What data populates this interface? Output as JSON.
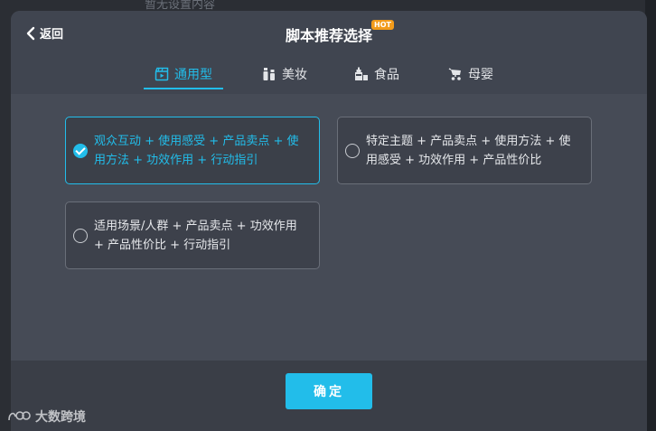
{
  "backdrop": {
    "partial_text": "暂无设置内容"
  },
  "header": {
    "back_label": "返回",
    "title": "脚本推荐选择",
    "badge": "HOT"
  },
  "tabs": [
    {
      "label": "通用型",
      "icon": "clapperboard-icon",
      "active": true
    },
    {
      "label": "美妆",
      "icon": "cosmetics-icon",
      "active": false
    },
    {
      "label": "食品",
      "icon": "food-icon",
      "active": false
    },
    {
      "label": "母婴",
      "icon": "stroller-icon",
      "active": false
    }
  ],
  "options": [
    {
      "text": "观众互动 + 使用感受 + 产品卖点 + 使用方法 + 功效作用 + 行动指引",
      "selected": true
    },
    {
      "text": "特定主题 + 产品卖点 + 使用方法 + 使用感受 + 功效作用 + 产品性价比",
      "selected": false
    },
    {
      "text": "适用场景/人群 + 产品卖点 + 功效作用 + 产品性价比 + 行动指引",
      "selected": false
    }
  ],
  "footer": {
    "confirm_label": "确定"
  },
  "watermark": {
    "text": "大数跨境"
  },
  "colors": {
    "accent": "#22bdea",
    "badge": "#f29b1b",
    "modal_bg": "#464b56"
  }
}
